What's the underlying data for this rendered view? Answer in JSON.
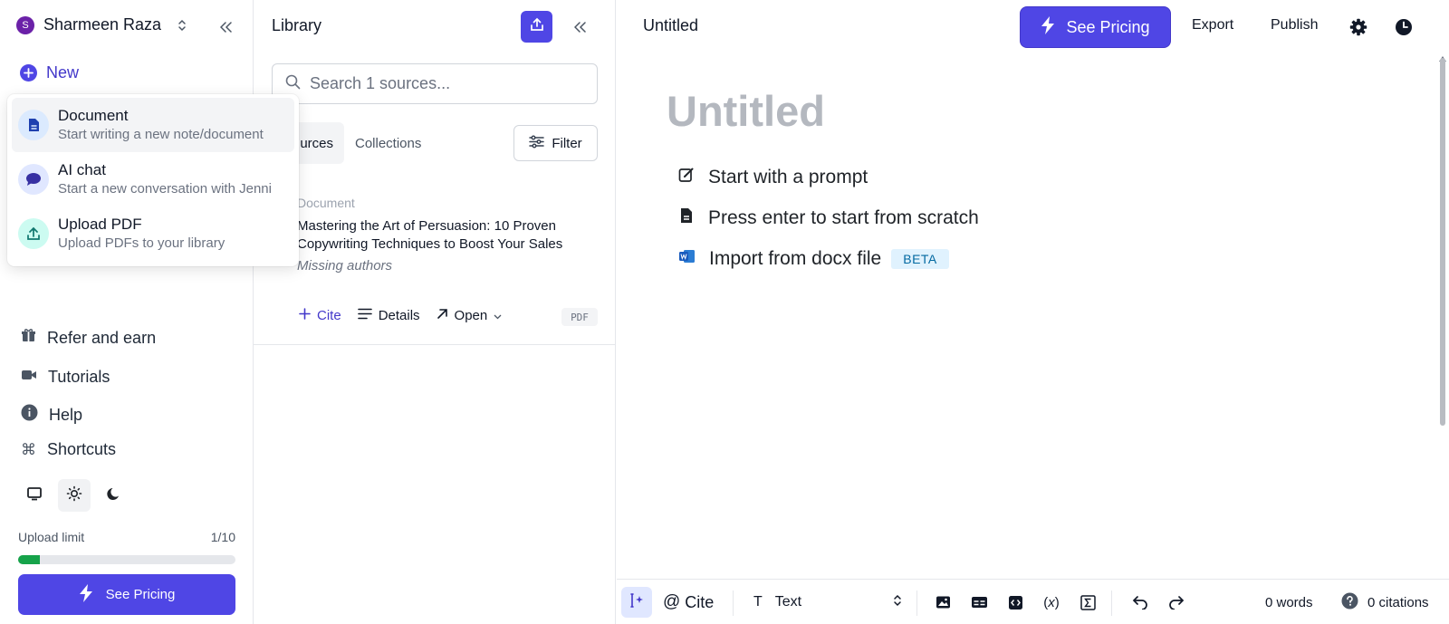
{
  "sidebar": {
    "user": {
      "initial": "S",
      "name": "Sharmeen Raza"
    },
    "new_label": "New",
    "new_menu": [
      {
        "title": "Document",
        "subtitle": "Start writing a new note/document",
        "icon": "document-icon"
      },
      {
        "title": "AI chat",
        "subtitle": "Start a new conversation with Jenni",
        "icon": "chat-icon"
      },
      {
        "title": "Upload PDF",
        "subtitle": "Upload PDFs to your library",
        "icon": "upload-icon"
      }
    ],
    "links": [
      {
        "label": "Refer and earn",
        "icon": "gift-icon"
      },
      {
        "label": "Tutorials",
        "icon": "video-icon"
      },
      {
        "label": "Help",
        "icon": "info-icon"
      },
      {
        "label": "Shortcuts",
        "icon": "command-icon"
      }
    ],
    "theme_options": [
      "system",
      "light",
      "dark"
    ],
    "theme_selected": "light",
    "upload_limit": {
      "label": "Upload limit",
      "count": "1/10",
      "fraction": 0.1
    },
    "see_pricing": "See Pricing"
  },
  "library": {
    "title": "Library",
    "search_placeholder": "Search 1 sources...",
    "tabs": [
      "urces",
      "Collections"
    ],
    "filter_label": "Filter",
    "source": {
      "type": "Document",
      "title": "Mastering the Art of Persuasion: 10 Proven Copywriting Techniques to Boost Your Sales",
      "authors": "Missing authors",
      "actions": {
        "cite": "Cite",
        "details": "Details",
        "open": "Open"
      },
      "badge": "PDF"
    }
  },
  "editor": {
    "doc_name": "Untitled",
    "see_pricing": "See Pricing",
    "export": "Export",
    "publish": "Publish",
    "title_placeholder": "Untitled",
    "options": [
      {
        "label": "Start with a prompt",
        "icon": "edit-icon"
      },
      {
        "label": "Press enter to start from scratch",
        "icon": "file-icon"
      },
      {
        "label": "Import from docx file",
        "icon": "word-icon",
        "badge": "BETA"
      }
    ],
    "bottombar": {
      "cite": "Cite",
      "text_style": "Text",
      "words": "0 words",
      "citations": "0 citations"
    }
  },
  "colors": {
    "accent": "#4f46e5",
    "progress": "#16a34a"
  }
}
